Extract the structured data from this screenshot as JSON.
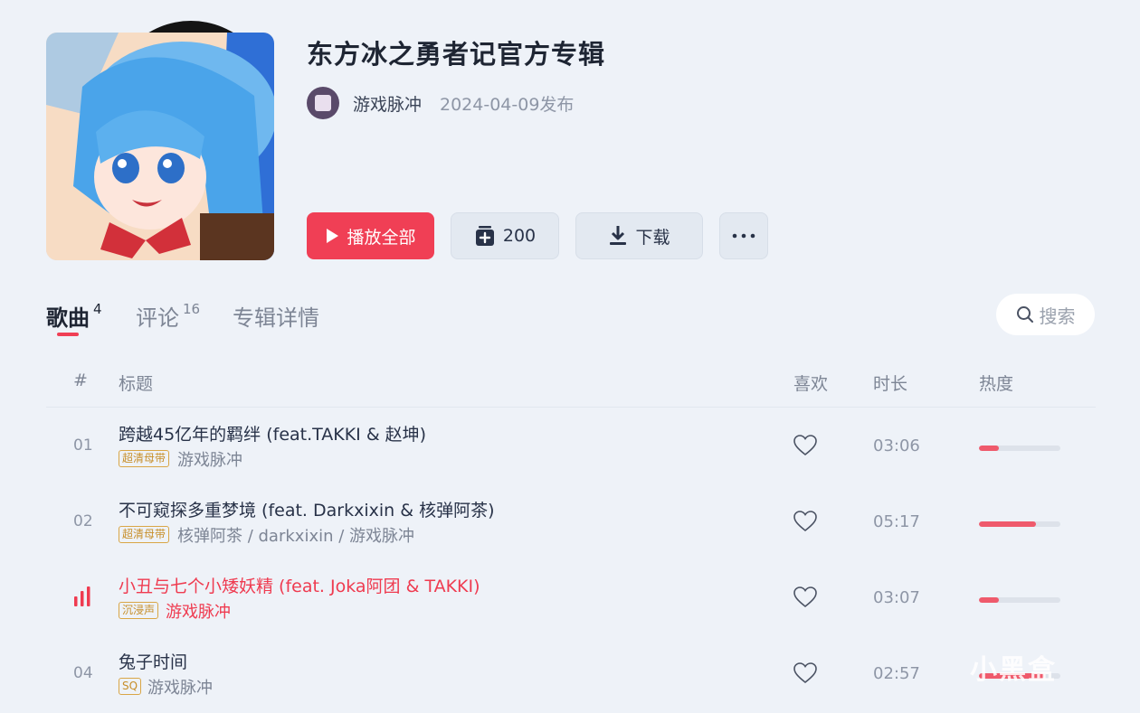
{
  "album": {
    "title": "东方冰之勇者记官方专辑",
    "artist": "游戏脉冲",
    "release": "2024-04-09发布"
  },
  "actions": {
    "play_all": "播放全部",
    "collect_count": "200",
    "download": "下载"
  },
  "tabs": [
    {
      "label": "歌曲",
      "count": "4"
    },
    {
      "label": "评论",
      "count": "16"
    },
    {
      "label": "专辑详情",
      "count": ""
    }
  ],
  "search": {
    "placeholder": "搜索"
  },
  "table": {
    "headers": {
      "num": "#",
      "title": "标题",
      "like": "喜欢",
      "duration": "时长",
      "heat": "热度"
    },
    "rows": [
      {
        "num": "01",
        "title": "跨越45亿年的羁绊 (feat.TAKKI & 赵坤)",
        "tag": "超清母带",
        "artist": "游戏脉冲",
        "duration": "03:06",
        "heat": 0.24,
        "playing": false
      },
      {
        "num": "02",
        "title": "不可窥探多重梦境 (feat. Darkxixin & 核弹阿茶)",
        "tag": "超清母带",
        "artist": "核弹阿茶 / darkxixin / 游戏脉冲",
        "duration": "05:17",
        "heat": 0.7,
        "playing": false
      },
      {
        "num": "03",
        "title": "小丑与七个小矮妖精 (feat. Joka阿团 & TAKKI)",
        "tag": "沉浸声",
        "artist": "游戏脉冲",
        "duration": "03:07",
        "heat": 0.24,
        "playing": true
      },
      {
        "num": "04",
        "title": "兔子时间",
        "tag": "SQ",
        "artist": "游戏脉冲",
        "duration": "02:57",
        "heat": 0.8,
        "playing": false
      }
    ]
  },
  "watermark": "小黑盒",
  "colors": {
    "accent": "#f03f55",
    "background": "#eef2f8"
  }
}
